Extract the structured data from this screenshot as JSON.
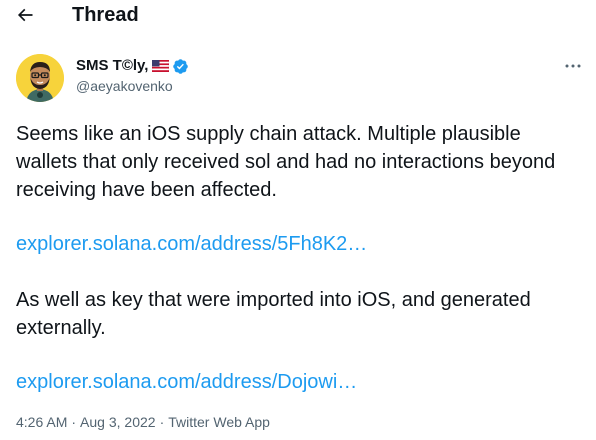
{
  "header": {
    "back_icon": "arrow-left-icon",
    "title": "Thread"
  },
  "tweet": {
    "author": {
      "display_name": "SMS T©ly,",
      "handle": "@aeyakovenko",
      "flag_icon": "us-flag-icon",
      "verified_icon": "verified-badge-icon"
    },
    "more_icon": "more-dots-icon",
    "paragraph_1": "Seems like an iOS supply chain attack. Multiple plausible wallets that only received sol and had no interactions beyond receiving have been affected.",
    "link_1": "explorer.solana.com/address/5Fh8K2…",
    "paragraph_2": "As well as key that were imported into iOS, and generated externally.",
    "link_2": "explorer.solana.com/address/Dojowi…",
    "time": "4:26 AM",
    "date": "Aug 3, 2022",
    "separator": "·",
    "source": "Twitter Web App"
  },
  "colors": {
    "text_primary": "#0f1419",
    "text_secondary": "#536471",
    "link": "#1d9bf0",
    "verified": "#1d9bf0"
  }
}
